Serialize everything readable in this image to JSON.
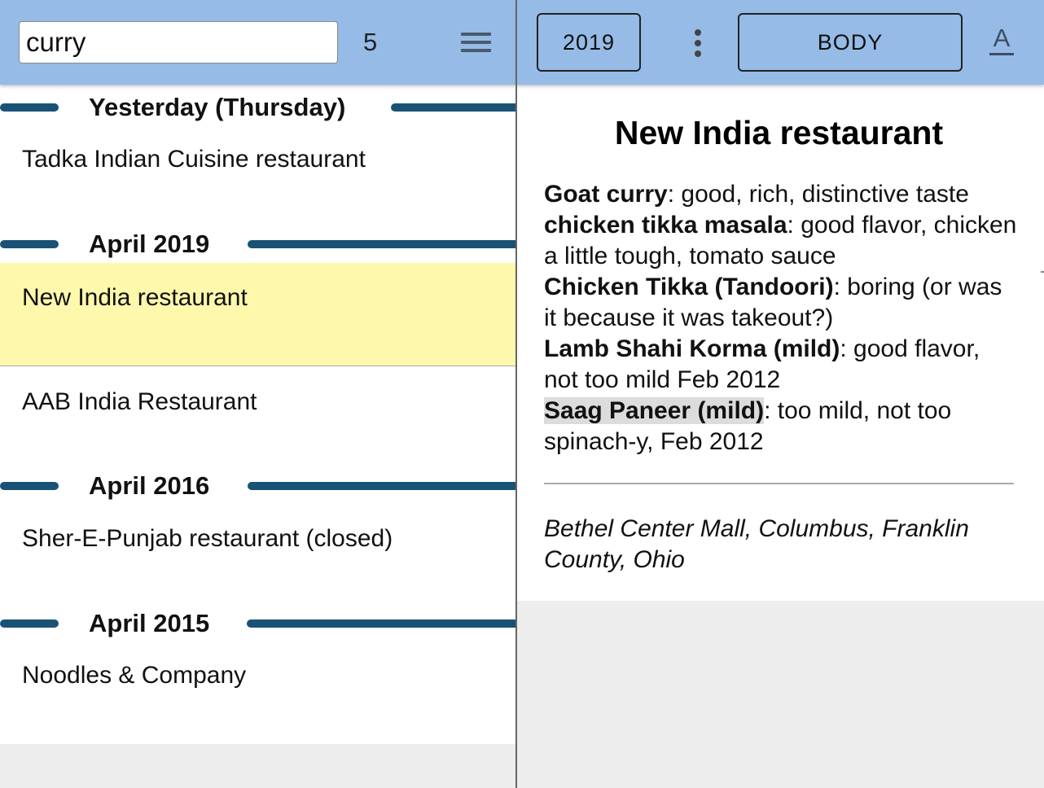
{
  "search": {
    "value": "curry",
    "result_count": "5"
  },
  "menu_icon": "hamburger-menu-icon",
  "list": {
    "groups": [
      {
        "header": "Yesterday (Thursday)",
        "items": [
          "Tadka Indian Cuisine restaurant"
        ]
      },
      {
        "header": "April 2019",
        "items": [
          "New India restaurant",
          "AAB India Restaurant"
        ]
      },
      {
        "header": "April 2016",
        "items": [
          "Sher-E-Punjab restaurant (closed)"
        ]
      },
      {
        "header": "April 2015",
        "items": [
          "Noodles & Company"
        ]
      }
    ],
    "selected_item": "New India restaurant"
  },
  "detail_toolbar": {
    "year_button": "2019",
    "body_button": "BODY",
    "kebab_icon": "more-vertical-icon",
    "font_icon": "font-format-icon",
    "font_glyph": "A"
  },
  "detail": {
    "title": "New India restaurant",
    "notes": [
      {
        "dish": "Goat curry",
        "comment": ": good, rich, distinctive taste"
      },
      {
        "dish": "chicken tikka masala",
        "comment": ": good flavor, chicken a little tough, tomato sauce"
      },
      {
        "dish": "Chicken Tikka (Tandoori)",
        "comment": ": boring (or was it because it was takeout?)"
      },
      {
        "dish": "Lamb Shahi Korma (mild)",
        "comment": ": good flavor, not too mild Feb 2012"
      },
      {
        "dish": "Saag Paneer (mild)",
        "comment": ": too mild, not too spinach-y, Feb 2012",
        "highlighted": true
      }
    ],
    "location": "Bethel Center Mall, Columbus, Franklin County, Ohio"
  },
  "colors": {
    "toolbar": "#96bbe6",
    "group_bar": "#1a5276",
    "selected_row": "#fef8ad",
    "background": "#ededed"
  }
}
